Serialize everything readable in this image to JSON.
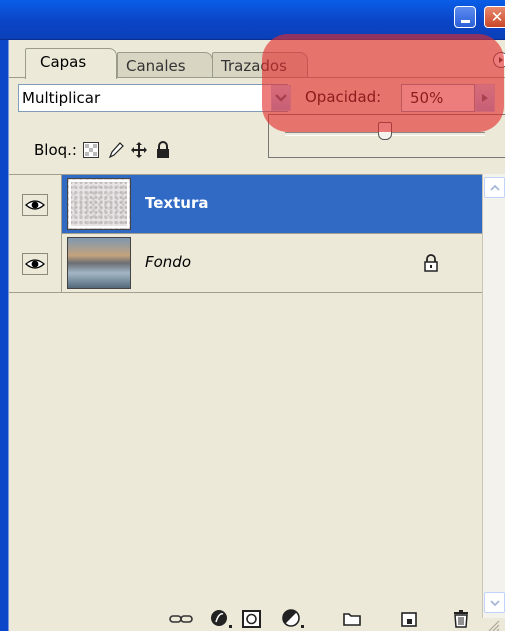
{
  "window": {
    "close_glyph": "✕"
  },
  "tabs": [
    {
      "label": "Capas",
      "active": true
    },
    {
      "label": "Canales",
      "active": false
    },
    {
      "label": "Trazados",
      "active": false
    }
  ],
  "blend": {
    "mode": "Multiplicar",
    "opacity_label": "Opacidad:",
    "opacity_value": "50%",
    "opacity_percent": 50
  },
  "lock": {
    "label": "Bloq.:",
    "icons": [
      "lock-transparent-icon",
      "lock-image-icon",
      "lock-position-icon",
      "lock-all-icon"
    ]
  },
  "layers": [
    {
      "name": "Textura",
      "visible": true,
      "selected": true,
      "locked": false
    },
    {
      "name": "Fondo",
      "visible": true,
      "selected": false,
      "locked": true
    }
  ],
  "toolbar_icons": [
    "link-layers-icon",
    "layer-style-icon",
    "layer-mask-icon",
    "adjustment-layer-icon",
    "new-group-icon",
    "new-layer-icon",
    "delete-layer-icon"
  ],
  "colors": {
    "selection": "#316ac5",
    "title_bar": "#0b46c8",
    "panel": "#ece9d8",
    "highlight": "#e22c2c"
  }
}
